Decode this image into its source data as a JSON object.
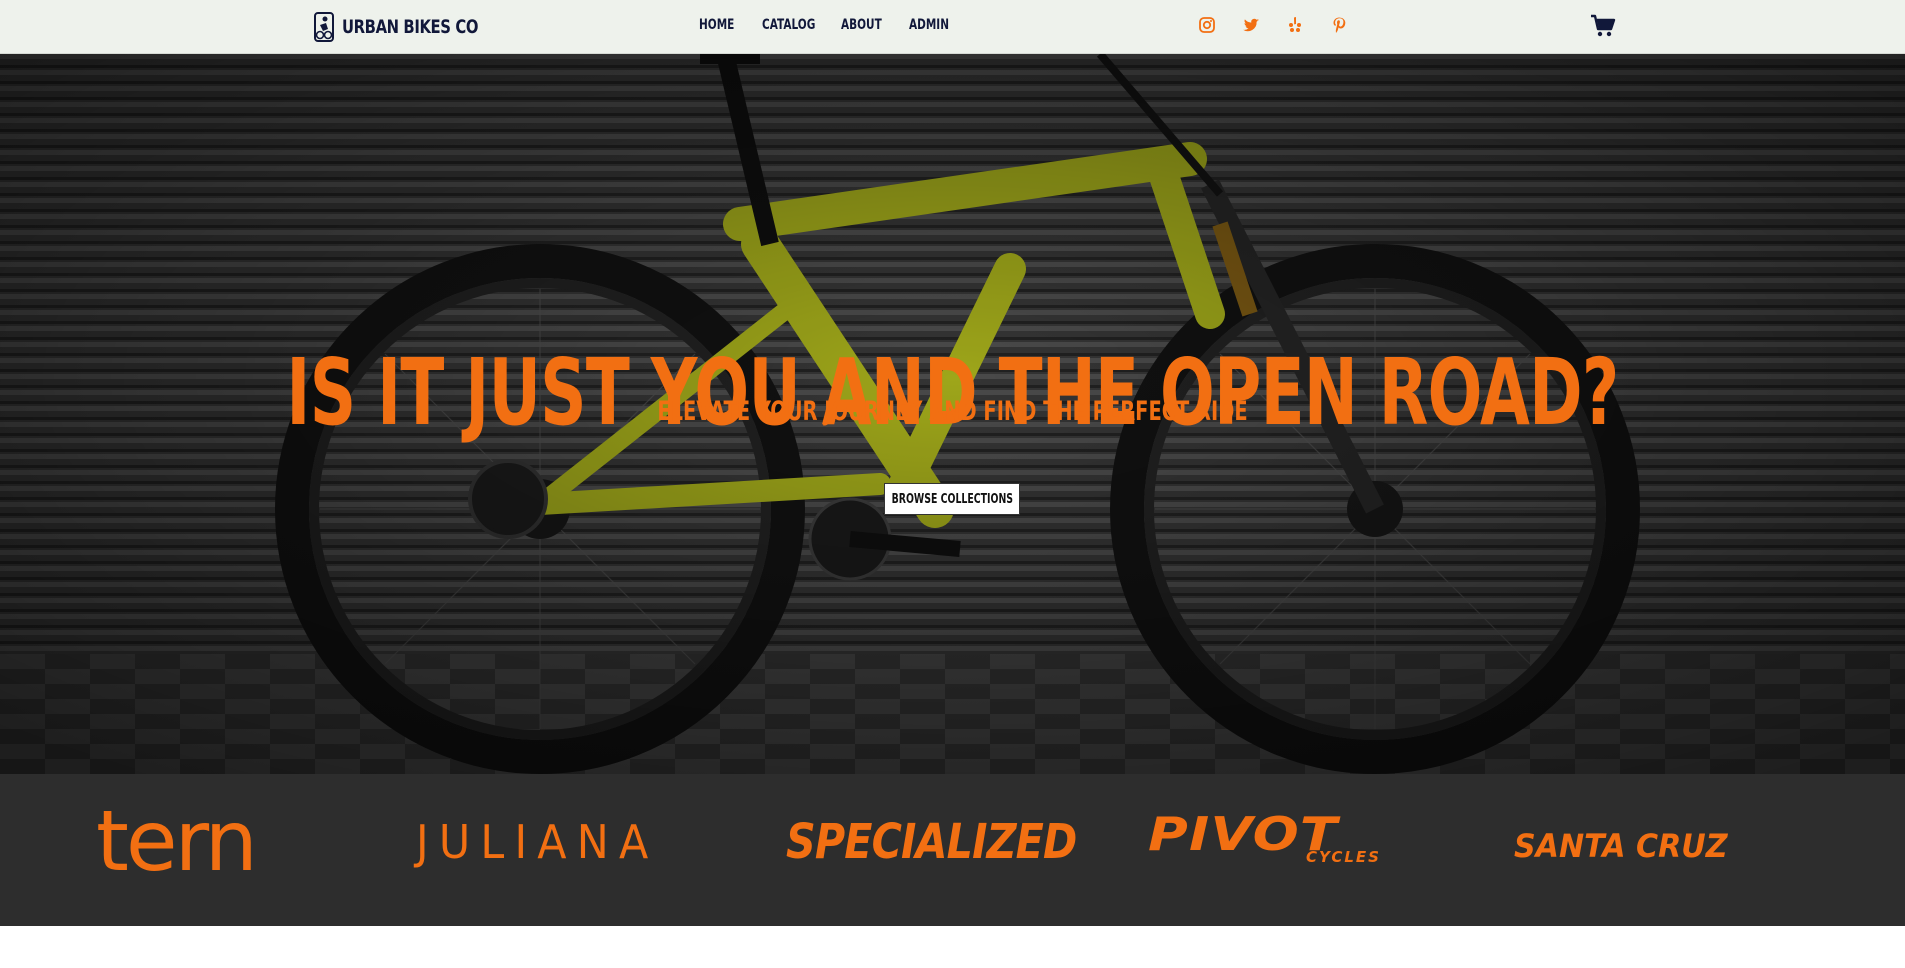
{
  "header": {
    "brand_name": "URBAN BIKES CO",
    "nav": [
      {
        "label": "HOME"
      },
      {
        "label": "CATALOG"
      },
      {
        "label": "ABOUT"
      },
      {
        "label": "ADMIN"
      }
    ],
    "social_icons": [
      "instagram-icon",
      "twitter-icon",
      "yelp-icon",
      "pinterest-icon"
    ],
    "cart_icon": "shopping-cart-icon"
  },
  "hero": {
    "title": "IS IT JUST YOU AND THE OPEN ROAD?",
    "subtitle": "ELEVATE YOUR JOURNEY AND FIND THE PERFECT RIDE",
    "cta_label": "BROWSE COLLECTIONS"
  },
  "brands": [
    {
      "name": "tern"
    },
    {
      "name": "JULIANA"
    },
    {
      "name": "SPECIALIZED"
    },
    {
      "name": "PIVOT",
      "sub": "CYCLES"
    },
    {
      "name": "SANTA CRUZ"
    }
  ],
  "colors": {
    "accent": "#f26f12",
    "navy": "#11183a",
    "header_bg": "#eef2ec",
    "brands_bg": "#2d2d2d"
  }
}
